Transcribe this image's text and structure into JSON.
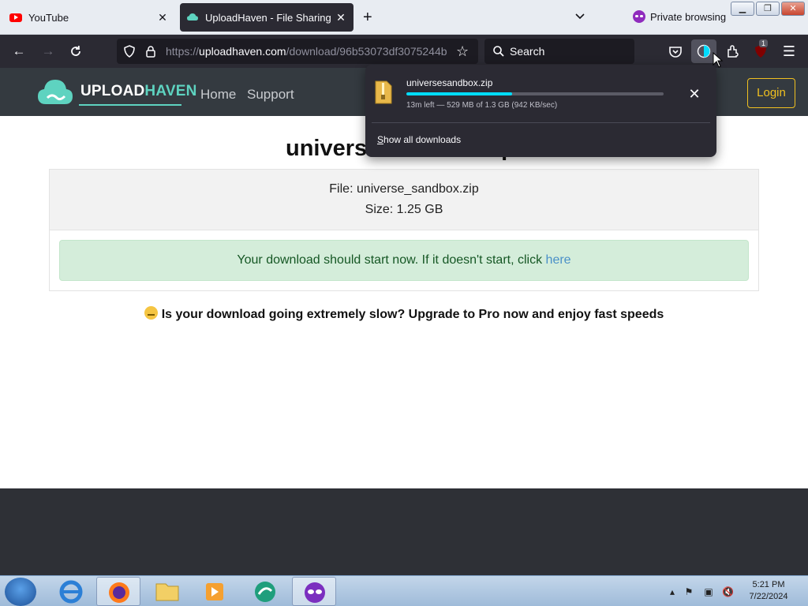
{
  "browser": {
    "tabs": [
      {
        "title": "YouTube",
        "active": false
      },
      {
        "title": "UploadHaven - File Sharing Made Simple",
        "active": true
      }
    ],
    "private_label": "Private browsing",
    "url": {
      "scheme": "https://",
      "domain": "uploadhaven.com",
      "path": "/download/96b53073df3075244b"
    },
    "search_placeholder": "Search",
    "extension_badge": "1"
  },
  "site": {
    "logo_part1": "UPLOAD",
    "logo_part2": "HAVEN",
    "nav": [
      "Home",
      "Support"
    ],
    "login_label": "Login",
    "accent_color": "#5ed3c0"
  },
  "page": {
    "heading": "univers",
    "heading_tail": "p",
    "file_line": "File: universe_sandbox.zip",
    "size_line": "Size: 1.25 GB",
    "alert_text": "Your download should start now. If it doesn't start, click ",
    "alert_link": "here",
    "slow_notice": "Is your download going extremely slow? Upgrade to Pro now and enjoy fast speeds"
  },
  "downloads_panel": {
    "file_name": "universesandbox.zip",
    "progress_fraction": 0.41,
    "status": "13m left — 529 MB of 1.3 GB (942 KB/sec)",
    "show_all_label": "Show all downloads",
    "show_all_mnemonic": "S",
    "show_all_rest": "how all downloads"
  },
  "taskbar": {
    "time": "5:21 PM",
    "date": "7/22/2024"
  }
}
